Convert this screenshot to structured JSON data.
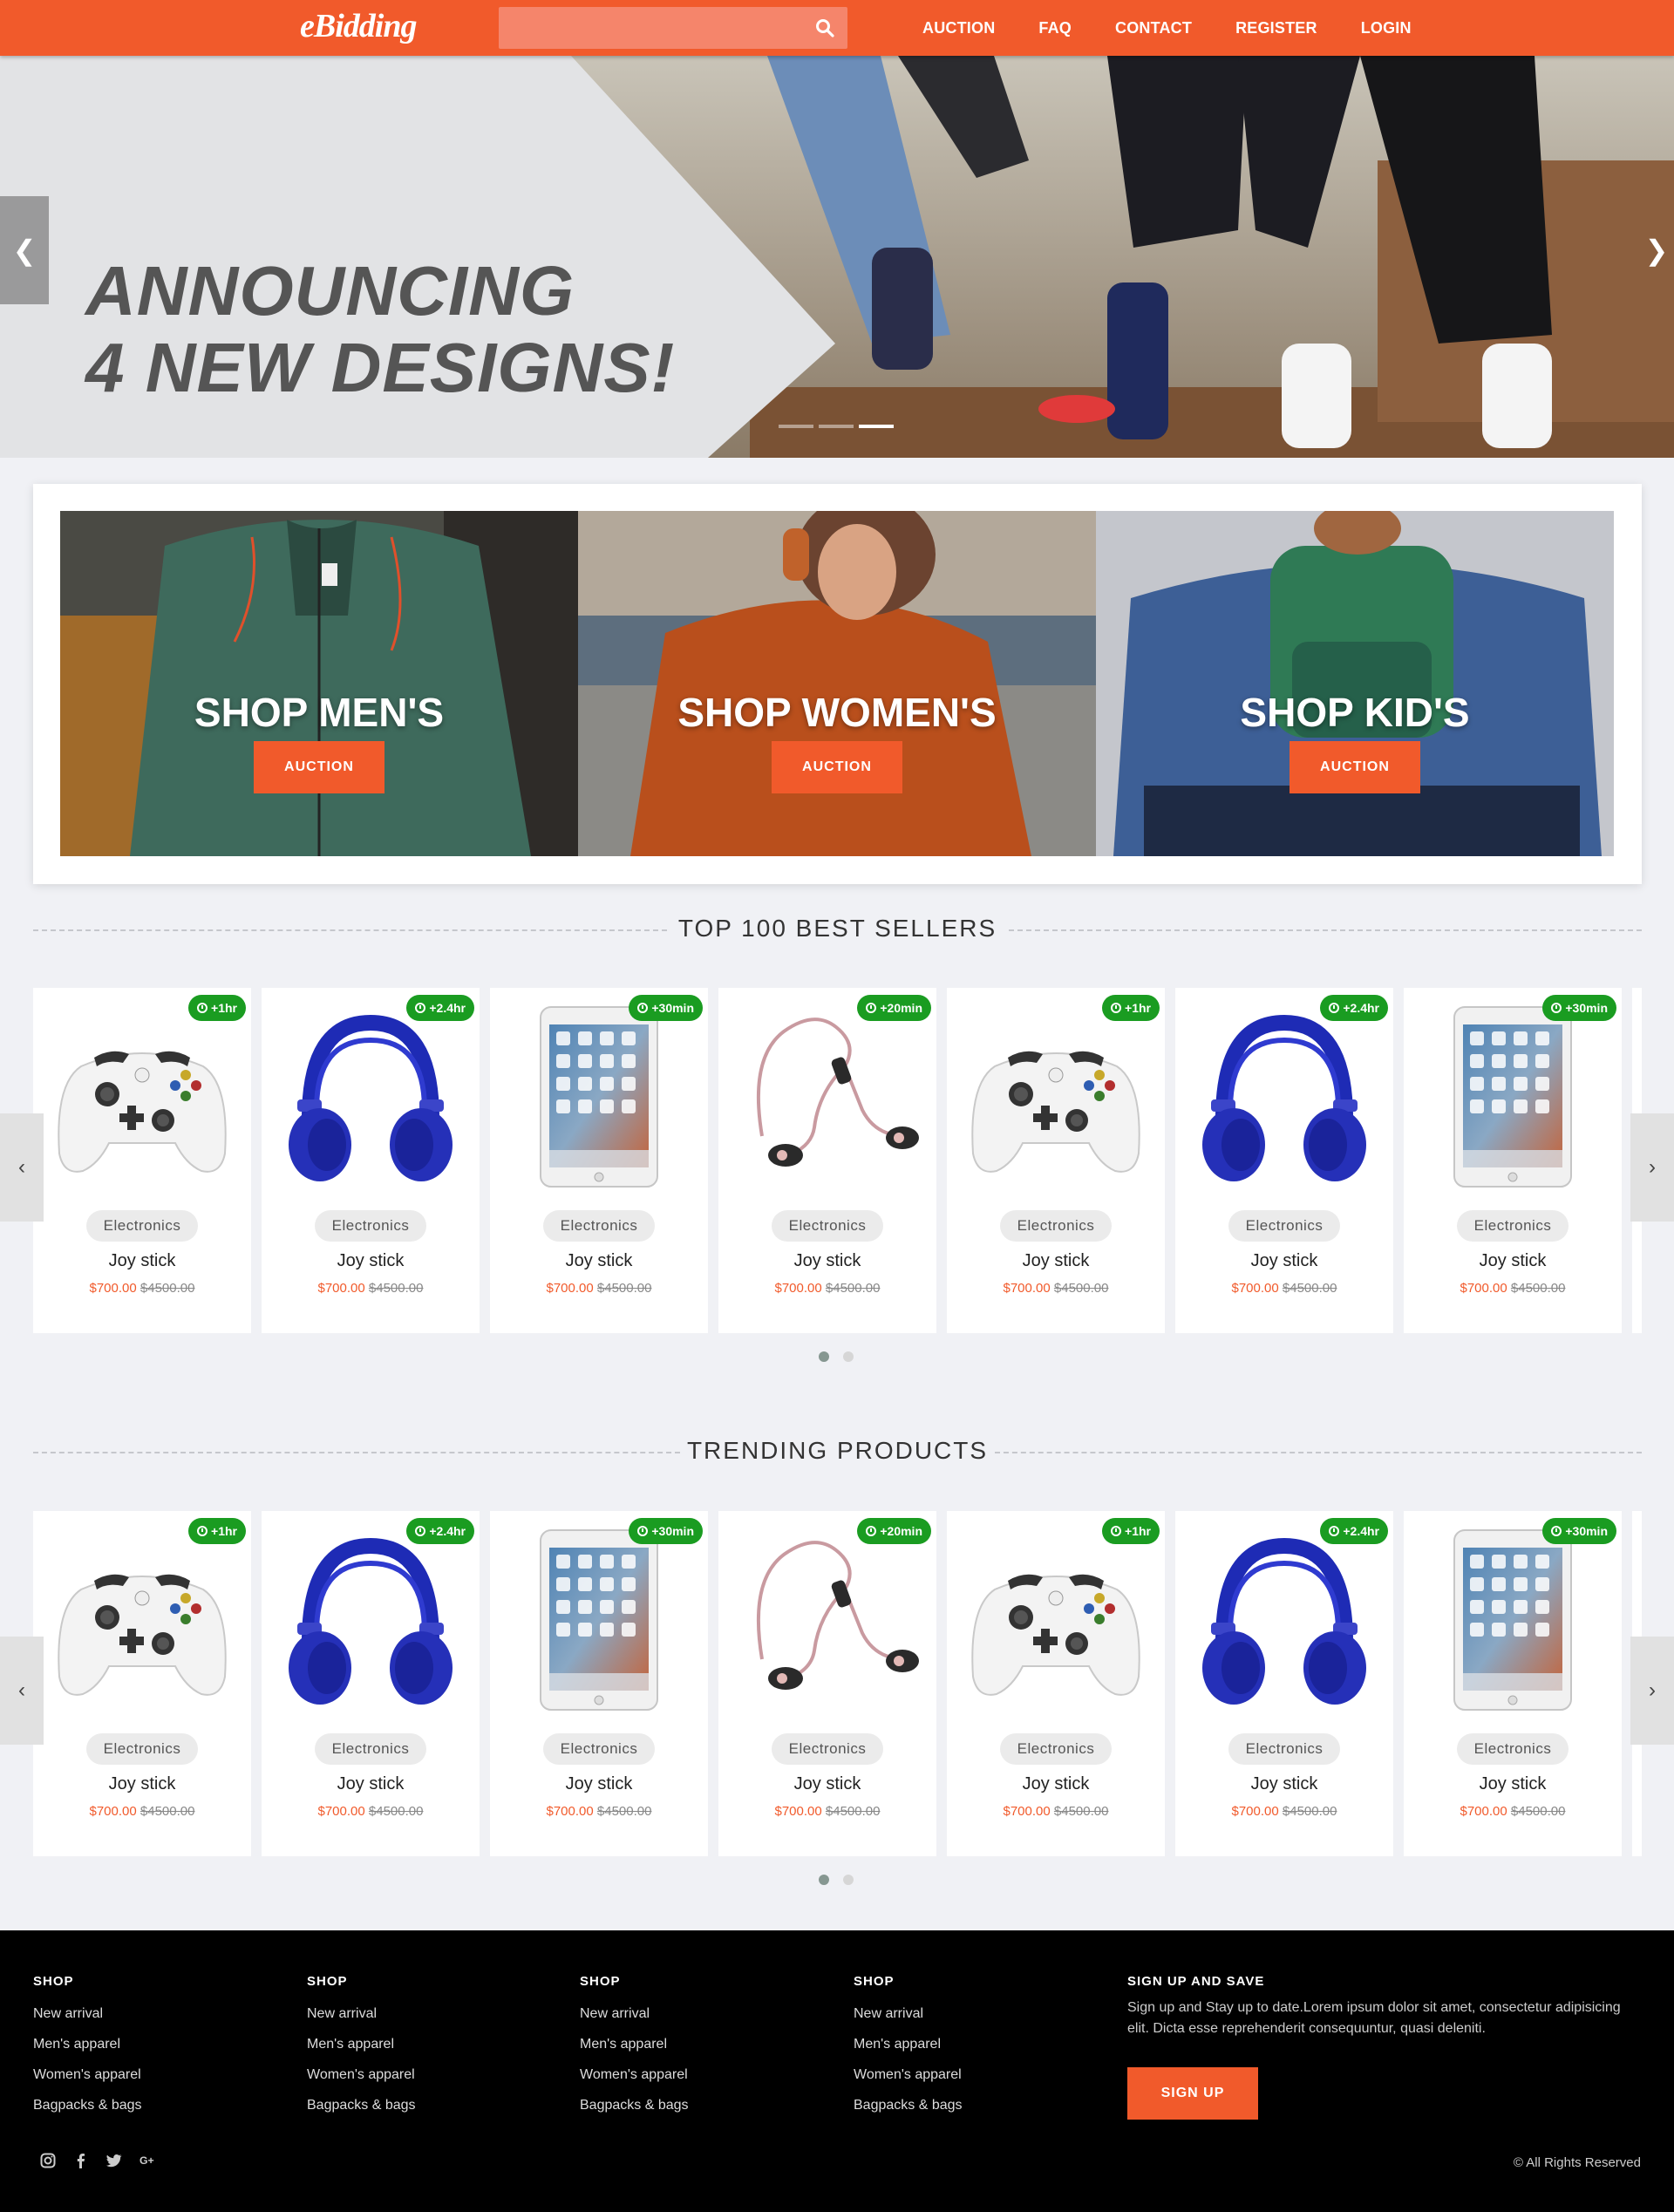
{
  "brand": {
    "logo": "eBidding",
    "accent": "#f15a2b",
    "badge_color": "#1a9c21"
  },
  "search": {
    "value": "",
    "placeholder": ""
  },
  "nav": [
    "AUCTION",
    "FAQ",
    "CONTACT",
    "REGISTER",
    "LOGIN"
  ],
  "hero": {
    "line1": "ANNOUNCING",
    "line2": "4 NEW DESIGNS!",
    "slide_count": 3,
    "active_slide": 3
  },
  "categories": [
    {
      "title": "SHOP MEN'S",
      "button": "AUCTION"
    },
    {
      "title": "SHOP WOMEN'S",
      "button": "AUCTION"
    },
    {
      "title": "SHOP KID'S",
      "button": "AUCTION"
    }
  ],
  "sections": [
    {
      "title": "TOP 100 BEST SELLERS",
      "products": [
        {
          "image": "gamepad",
          "badge": "+1hr",
          "category": "Electronics",
          "name": "Joy stick",
          "price": "$700.00",
          "old_price": "$4500.00"
        },
        {
          "image": "headphones",
          "badge": "+2.4hr",
          "category": "Electronics",
          "name": "Joy stick",
          "price": "$700.00",
          "old_price": "$4500.00"
        },
        {
          "image": "tablet",
          "badge": "+30min",
          "category": "Electronics",
          "name": "Joy stick",
          "price": "$700.00",
          "old_price": "$4500.00"
        },
        {
          "image": "earphones",
          "badge": "+20min",
          "category": "Electronics",
          "name": "Joy stick",
          "price": "$700.00",
          "old_price": "$4500.00"
        },
        {
          "image": "gamepad",
          "badge": "+1hr",
          "category": "Electronics",
          "name": "Joy stick",
          "price": "$700.00",
          "old_price": "$4500.00"
        },
        {
          "image": "headphones",
          "badge": "+2.4hr",
          "category": "Electronics",
          "name": "Joy stick",
          "price": "$700.00",
          "old_price": "$4500.00"
        },
        {
          "image": "tablet",
          "badge": "+30min",
          "category": "Electronics",
          "name": "Joy stick",
          "price": "$700.00",
          "old_price": "$4500.00"
        }
      ],
      "page_count": 2,
      "active_page": 1
    },
    {
      "title": "TRENDING PRODUCTS",
      "products": [
        {
          "image": "gamepad",
          "badge": "+1hr",
          "category": "Electronics",
          "name": "Joy stick",
          "price": "$700.00",
          "old_price": "$4500.00"
        },
        {
          "image": "headphones",
          "badge": "+2.4hr",
          "category": "Electronics",
          "name": "Joy stick",
          "price": "$700.00",
          "old_price": "$4500.00"
        },
        {
          "image": "tablet",
          "badge": "+30min",
          "category": "Electronics",
          "name": "Joy stick",
          "price": "$700.00",
          "old_price": "$4500.00"
        },
        {
          "image": "earphones",
          "badge": "+20min",
          "category": "Electronics",
          "name": "Joy stick",
          "price": "$700.00",
          "old_price": "$4500.00"
        },
        {
          "image": "gamepad",
          "badge": "+1hr",
          "category": "Electronics",
          "name": "Joy stick",
          "price": "$700.00",
          "old_price": "$4500.00"
        },
        {
          "image": "headphones",
          "badge": "+2.4hr",
          "category": "Electronics",
          "name": "Joy stick",
          "price": "$700.00",
          "old_price": "$4500.00"
        },
        {
          "image": "tablet",
          "badge": "+30min",
          "category": "Electronics",
          "name": "Joy stick",
          "price": "$700.00",
          "old_price": "$4500.00"
        }
      ],
      "page_count": 2,
      "active_page": 1
    }
  ],
  "footer": {
    "columns": [
      {
        "title": "SHOP",
        "links": [
          "New arrival",
          "Men's apparel",
          "Women's apparel",
          "Bagpacks & bags"
        ]
      },
      {
        "title": "SHOP",
        "links": [
          "New arrival",
          "Men's apparel",
          "Women's apparel",
          "Bagpacks & bags"
        ]
      },
      {
        "title": "SHOP",
        "links": [
          "New arrival",
          "Men's apparel",
          "Women's apparel",
          "Bagpacks & bags"
        ]
      },
      {
        "title": "SHOP",
        "links": [
          "New arrival",
          "Men's apparel",
          "Women's apparel",
          "Bagpacks & bags"
        ]
      }
    ],
    "signup": {
      "title": "SIGN UP AND SAVE",
      "text": "Sign up and Stay up to date.Lorem ipsum dolor sit amet, consectetur adipisicing elit. Dicta esse reprehenderit consequuntur, quasi deleniti.",
      "button": "SIGN UP"
    },
    "socials": [
      "instagram-icon",
      "facebook-icon",
      "twitter-icon",
      "google-plus-icon"
    ],
    "copyright": "© All Rights Reserved"
  }
}
